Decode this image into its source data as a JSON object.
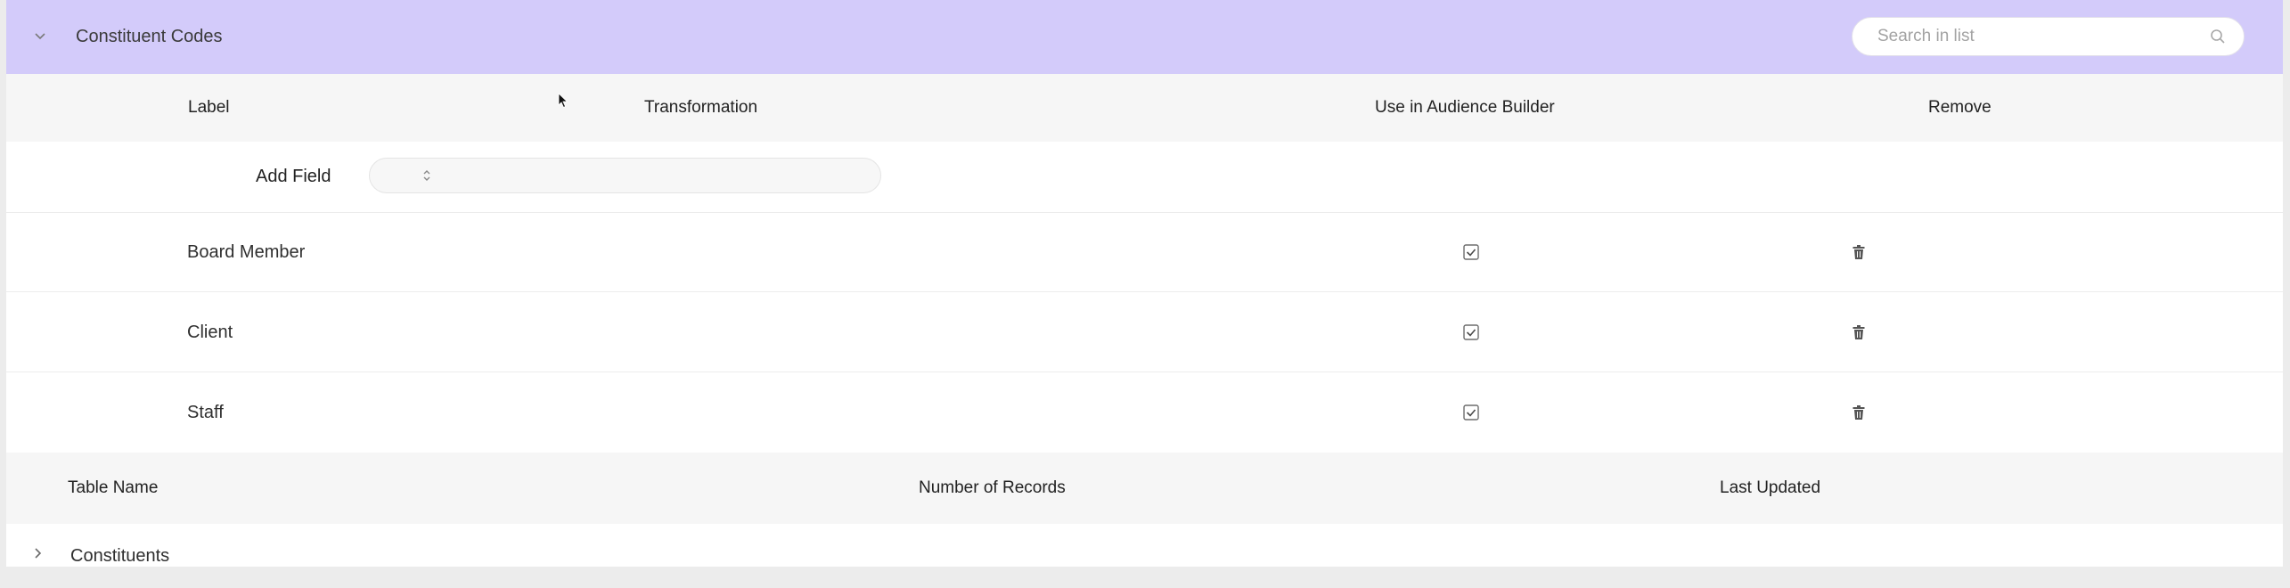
{
  "section": {
    "title": "Constituent Codes",
    "search_placeholder": "Search in list"
  },
  "columns": {
    "label": "Label",
    "transformation": "Transformation",
    "audience": "Use in Audience Builder",
    "remove": "Remove"
  },
  "add_field": {
    "label": "Add Field",
    "value": ""
  },
  "rows": [
    {
      "label": "Board Member",
      "use_in_audience_builder": true
    },
    {
      "label": "Client",
      "use_in_audience_builder": true
    },
    {
      "label": "Staff",
      "use_in_audience_builder": true
    }
  ],
  "tables_header": {
    "name": "Table Name",
    "records": "Number of Records",
    "updated": "Last Updated"
  },
  "tables": [
    {
      "name": "Constituents"
    }
  ],
  "colors": {
    "header_bg": "#d3cbfa",
    "subheader_bg": "#f6f6f6"
  }
}
